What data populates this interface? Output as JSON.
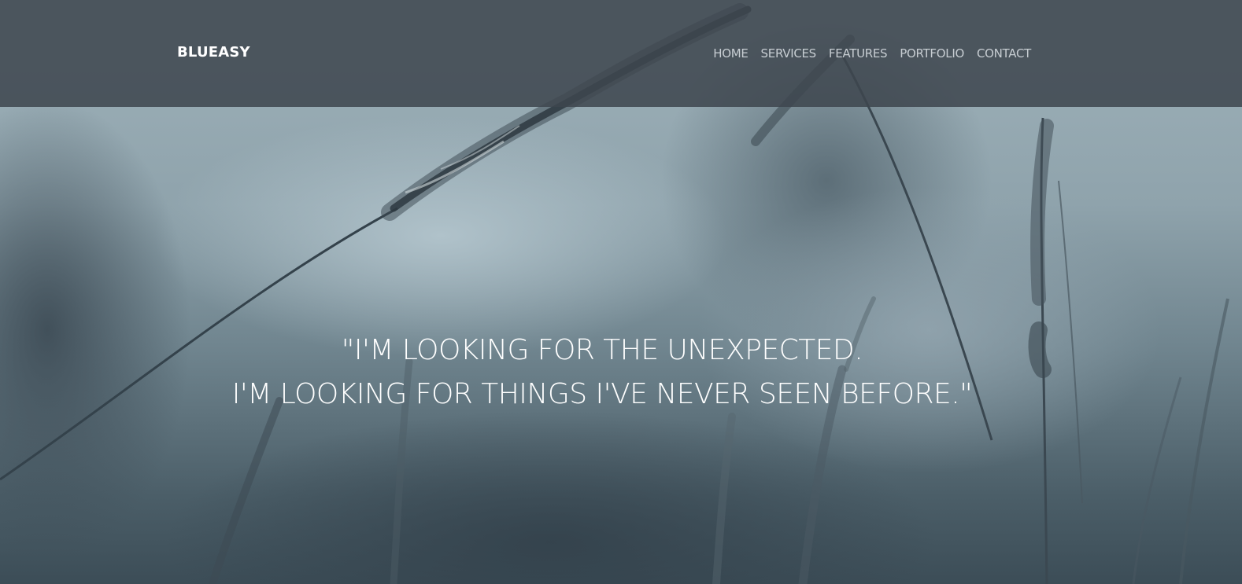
{
  "header": {
    "brand": "BLUEASY",
    "nav": [
      {
        "label": "HOME"
      },
      {
        "label": "SERVICES"
      },
      {
        "label": "FEATURES"
      },
      {
        "label": "PORTFOLIO"
      },
      {
        "label": "CONTACT"
      }
    ]
  },
  "hero": {
    "quote_line_1": "\"I'M LOOKING FOR THE UNEXPECTED.",
    "quote_line_2": "I'M LOOKING FOR THINGS I'VE NEVER SEEN BEFORE.\""
  },
  "colors": {
    "header_bg": "#3e464e",
    "brand_text": "#ffffff",
    "nav_text": "#c7cdd2",
    "quote_text": "#ffffff"
  }
}
